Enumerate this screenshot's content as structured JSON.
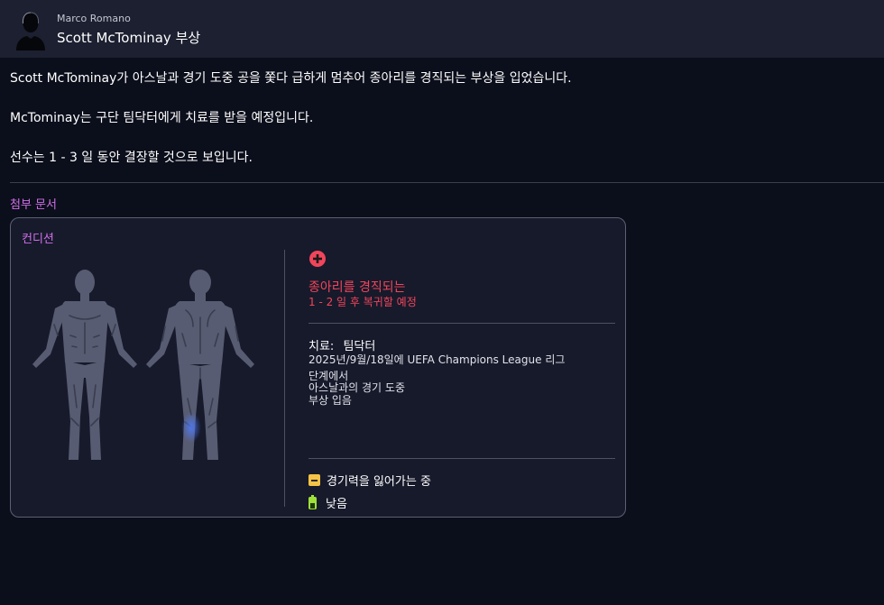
{
  "message": {
    "sender": "Marco Romano",
    "subject": "Scott McTominay 부상",
    "paragraphs": [
      "Scott McTominay가 아스날과 경기 도중 공을 쫓다 급하게 멈추어 종아리를 경직되는 부상을 입었습니다.",
      "McTominay는 구단 팀닥터에게 치료를 받을 예정입니다.",
      "선수는 1 - 3 일 동안 결장할 것으로 보입니다."
    ],
    "attachments_title": "첨부 문서"
  },
  "card": {
    "title": "컨디션",
    "injury_name": "종아리를 경직되는",
    "return_estimate": "1 - 2 일 후 복귀할 예정",
    "treatment_label": "치료:",
    "treatment_value": "팀닥터",
    "detail_lines": [
      "2025년/9월/18일에 UEFA Champions League 리그",
      "단계에서",
      "아스날과의 경기 도중",
      "부상 입음"
    ],
    "status_form": "경기력을 잃어가는 중",
    "status_fitness": "낮음"
  },
  "colors": {
    "accent_purple": "#d06fe8",
    "injury_red": "#f2455b",
    "form_yellow": "#f6c347",
    "fitness_green": "#9fe03a",
    "injury_highlight": "#4f7dff"
  },
  "icons": [
    "player-avatar-icon",
    "injury-plus-icon",
    "form-declining-icon",
    "battery-low-icon"
  ]
}
